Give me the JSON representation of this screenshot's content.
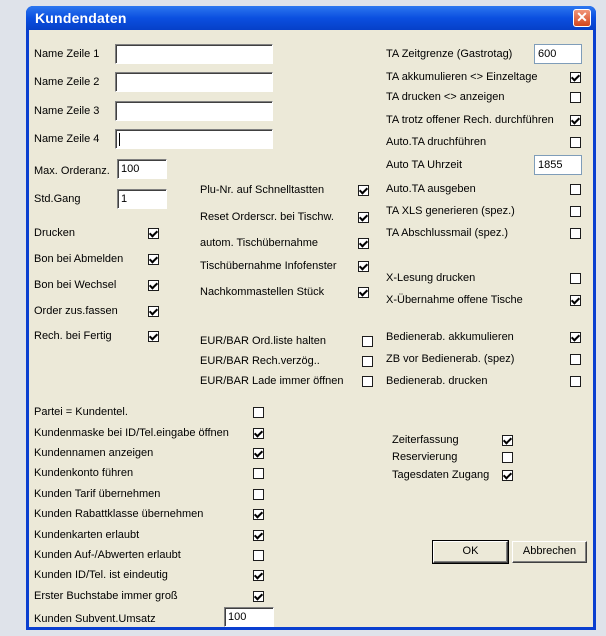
{
  "window": {
    "title": "Kundendaten"
  },
  "name_lines": [
    {
      "label": "Name Zeile 1",
      "value": ""
    },
    {
      "label": "Name Zeile 2",
      "value": ""
    },
    {
      "label": "Name Zeile 3",
      "value": ""
    },
    {
      "label": "Name Zeile 4",
      "value": ""
    }
  ],
  "order": {
    "max_label": "Max. Orderanz.",
    "max_value": "100",
    "std_label": "Std.Gang",
    "std_value": "1"
  },
  "left_options": [
    {
      "label": "Drucken",
      "checked": true
    },
    {
      "label": "Bon bei Abmelden",
      "checked": true
    },
    {
      "label": "Bon bei Wechsel",
      "checked": true
    },
    {
      "label": "Order zus.fassen",
      "checked": true
    },
    {
      "label": "Rech. bei Fertig",
      "checked": true
    }
  ],
  "mid_options": [
    {
      "label": "Plu-Nr. auf Schnelltastten",
      "checked": true
    },
    {
      "label": "Reset Orderscr. bei Tischw.",
      "checked": true
    },
    {
      "label": "autom. Tischübernahme",
      "checked": true
    },
    {
      "label": "Tischübernahme Infofenster",
      "checked": true
    },
    {
      "label": "Nachkommastellen Stück",
      "checked": true
    }
  ],
  "eur_options": [
    {
      "label": "EUR/BAR Ord.liste halten",
      "checked": false
    },
    {
      "label": "EUR/BAR Rech.verzög..",
      "checked": false
    },
    {
      "label": "EUR/BAR Lade immer öffnen",
      "checked": false
    }
  ],
  "ta": {
    "zeitgrenze_label": "TA Zeitgrenze (Gastrotag)",
    "zeitgrenze_value": "600",
    "options": [
      {
        "label": "TA akkumulieren <> Einzeltage",
        "checked": true
      },
      {
        "label": "TA drucken <> anzeigen",
        "checked": false
      },
      {
        "label": "TA trotz offener Rech. durchführen",
        "checked": true
      },
      {
        "label": "Auto.TA druchführen",
        "checked": false
      }
    ],
    "uhrzeit_label": "Auto TA Uhrzeit",
    "uhrzeit_value": "1855",
    "options2": [
      {
        "label": "Auto.TA ausgeben",
        "checked": false
      },
      {
        "label": "TA XLS generieren (spez.)",
        "checked": false
      },
      {
        "label": "TA Abschlussmail (spez.)",
        "checked": false
      }
    ]
  },
  "xlesung": [
    {
      "label": "X-Lesung drucken",
      "checked": false
    },
    {
      "label": "X-Übernahme offene Tische",
      "checked": true
    }
  ],
  "bediener": [
    {
      "label": "Bedienerab. akkumulieren",
      "checked": true
    },
    {
      "label": "ZB vor Bedienerab. (spez)",
      "checked": false
    },
    {
      "label": "Bedienerab. drucken",
      "checked": false
    }
  ],
  "kunden": [
    {
      "label": "Partei = Kundentel.",
      "checked": false
    },
    {
      "label": "Kundenmaske bei ID/Tel.eingabe öffnen",
      "checked": true
    },
    {
      "label": "Kundennamen anzeigen",
      "checked": true
    },
    {
      "label": "Kundenkonto führen",
      "checked": false
    },
    {
      "label": "Kunden Tarif übernehmen",
      "checked": false
    },
    {
      "label": "Kunden Rabattklasse übernehmen",
      "checked": true
    },
    {
      "label": "Kundenkarten erlaubt",
      "checked": true
    },
    {
      "label": "Kunden Auf-/Abwerten erlaubt",
      "checked": false
    },
    {
      "label": "Kunden ID/Tel. ist eindeutig",
      "checked": true
    },
    {
      "label": "Erster Buchstabe immer groß",
      "checked": true
    }
  ],
  "subvent": {
    "label": "Kunden Subvent.Umsatz",
    "value": "100"
  },
  "misc": [
    {
      "label": "Zeiterfassung",
      "checked": true
    },
    {
      "label": "Reservierung",
      "checked": false
    },
    {
      "label": "Tagesdaten Zugang",
      "checked": true
    }
  ],
  "buttons": {
    "ok": "OK",
    "cancel": "Abbrechen"
  }
}
